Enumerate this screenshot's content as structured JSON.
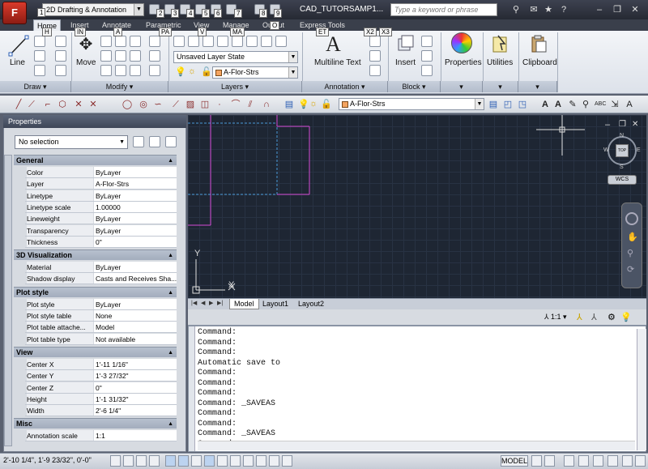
{
  "app": {
    "button_letter": "F",
    "doc_title": "CAD_TUTORSAMP1..."
  },
  "titlebar": {
    "workspace": "2D Drafting & Annotation",
    "search_placeholder": "Type a keyword or phrase",
    "keytips": [
      "1",
      "2",
      "3",
      "4",
      "5",
      "6",
      "7",
      "8",
      "9"
    ]
  },
  "tabs": [
    {
      "label": "Home",
      "keytip": "H"
    },
    {
      "label": "Insert",
      "keytip": "IN"
    },
    {
      "label": "Annotate",
      "keytip": "A"
    },
    {
      "label": "Parametric",
      "keytip": "PA"
    },
    {
      "label": "View",
      "keytip": "V"
    },
    {
      "label": "Manage",
      "keytip": "MA"
    },
    {
      "label": "Output",
      "keytip": "O"
    },
    {
      "label": "Express Tools",
      "keytip": "ET"
    }
  ],
  "extra_keytips": [
    "X2",
    "X3"
  ],
  "ribbon": {
    "line": "Line",
    "move": "Move",
    "layer_state": "Unsaved Layer State",
    "layer_name": "A-Flor-Strs",
    "mtext_glyph": "A",
    "multiline_text": "Multiline Text",
    "insert": "Insert",
    "properties": "Properties",
    "utilities": "Utilities",
    "clipboard": "Clipboard",
    "panels": [
      "Draw",
      "Modify",
      "Layers",
      "Annotation",
      "Block"
    ]
  },
  "toolbar": {
    "layer_name": "A-Flor-Strs"
  },
  "properties": {
    "title": "Properties",
    "selection": "No selection",
    "groups": [
      {
        "name": "General",
        "rows": [
          {
            "k": "Color",
            "v": "ByLayer"
          },
          {
            "k": "Layer",
            "v": "A-Flor-Strs"
          },
          {
            "k": "Linetype",
            "v": "ByLayer"
          },
          {
            "k": "Linetype scale",
            "v": "1.00000"
          },
          {
            "k": "Lineweight",
            "v": "ByLayer"
          },
          {
            "k": "Transparency",
            "v": "ByLayer"
          },
          {
            "k": "Thickness",
            "v": "0\""
          }
        ]
      },
      {
        "name": "3D Visualization",
        "rows": [
          {
            "k": "Material",
            "v": "ByLayer"
          },
          {
            "k": "Shadow display",
            "v": "Casts and Receives Sha..."
          }
        ]
      },
      {
        "name": "Plot style",
        "rows": [
          {
            "k": "Plot style",
            "v": "ByLayer"
          },
          {
            "k": "Plot style table",
            "v": "None"
          },
          {
            "k": "Plot table attache...",
            "v": "Model"
          },
          {
            "k": "Plot table type",
            "v": "Not available"
          }
        ]
      },
      {
        "name": "View",
        "rows": [
          {
            "k": "Center X",
            "v": "1'-11 1/16\""
          },
          {
            "k": "Center Y",
            "v": "1'-3 27/32\""
          },
          {
            "k": "Center Z",
            "v": "0\""
          },
          {
            "k": "Height",
            "v": "1'-1 31/32\""
          },
          {
            "k": "Width",
            "v": "2'-6 1/4\""
          }
        ]
      },
      {
        "name": "Misc",
        "rows": [
          {
            "k": "Annotation scale",
            "v": "1:1"
          }
        ]
      }
    ]
  },
  "viewcube": {
    "top": "TOP",
    "wcs": "WCS",
    "n": "N",
    "s": "S",
    "e": "E",
    "w": "W"
  },
  "ucs": {
    "x": "X",
    "y": "Y"
  },
  "layout_tabs": [
    "Model",
    "Layout1",
    "Layout2"
  ],
  "annotation_scale": "1:1",
  "command_lines": [
    "Command:",
    "Command:",
    "Command:",
    "Automatic save to",
    "Command:",
    "Command:",
    "Command:",
    "Command: _SAVEAS",
    "Command:",
    "Command:",
    "Command: _SAVEAS",
    "Command:"
  ],
  "status": {
    "coords": "2'-10 1/4\", 1'-9 23/32\", 0'-0\"",
    "model": "MODEL"
  }
}
